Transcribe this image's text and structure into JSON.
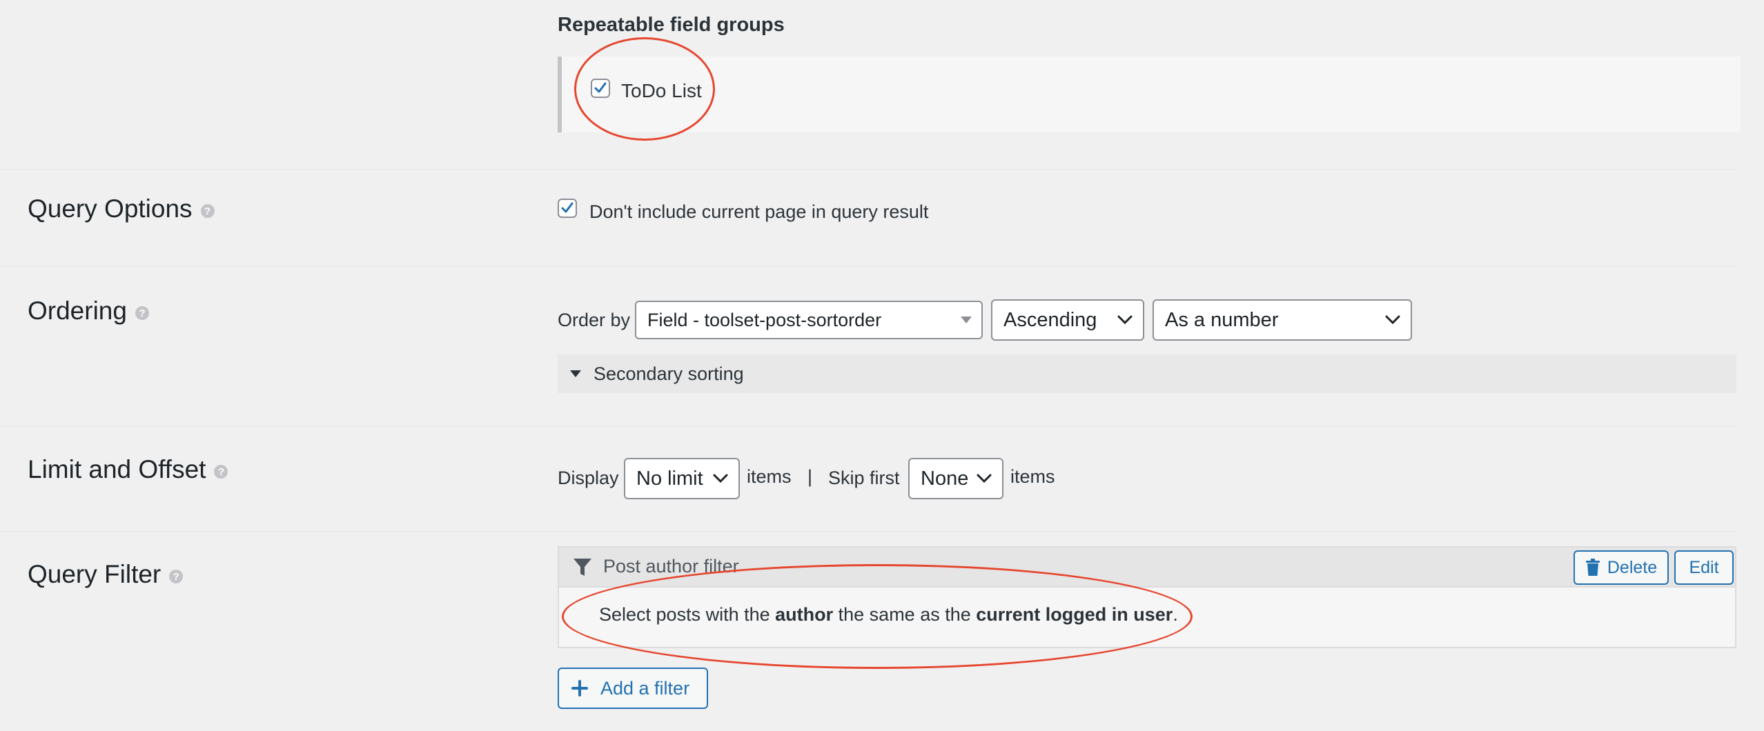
{
  "repeatable": {
    "title": "Repeatable field groups",
    "item_label": "ToDo List",
    "item_checked": true
  },
  "query_options": {
    "label": "Query Options",
    "checkbox_label": "Don't include current page in query result",
    "checked": true
  },
  "ordering": {
    "label": "Ordering",
    "order_by_label": "Order by",
    "field_select": "Field - toolset-post-sortorder",
    "direction_select": "Ascending",
    "type_select": "As a number",
    "secondary_label": "Secondary sorting"
  },
  "limit": {
    "label": "Limit and Offset",
    "display_label": "Display",
    "limit_select": "No limit",
    "items_label": "items",
    "divider": "|",
    "skip_label": "Skip first",
    "skip_select": "None",
    "items_label2": "items"
  },
  "query_filter": {
    "label": "Query Filter",
    "filter_title": "Post author filter",
    "delete_label": "Delete",
    "edit_label": "Edit",
    "desc_part1": "Select posts with the ",
    "desc_bold1": "author",
    "desc_part2": " the same as the ",
    "desc_bold2": "current logged in user",
    "desc_part3": ".",
    "add_filter_label": "Add a filter"
  },
  "colors": {
    "accent": "#2271b1",
    "annotation": "#e6472f",
    "background": "#f0f0f1"
  },
  "icons": [
    "checkmark-icon",
    "help-icon",
    "chevron-down-icon",
    "triangle-down-icon",
    "filter-icon",
    "trash-icon",
    "plus-icon"
  ]
}
